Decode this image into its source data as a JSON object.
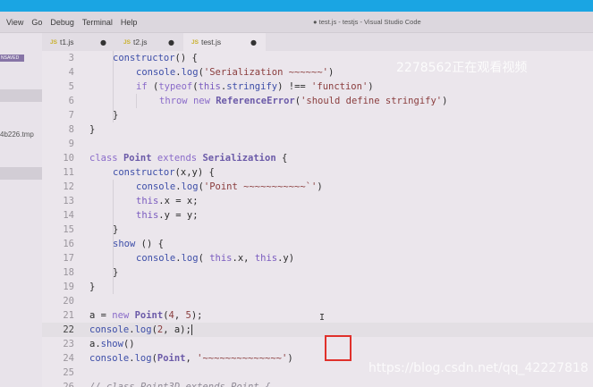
{
  "menu": [
    "View",
    "Go",
    "Debug",
    "Terminal",
    "Help"
  ],
  "window_title": "● test.js - testjs - Visual Studio Code",
  "tabs": [
    {
      "icon": "JS",
      "label": "t1.js",
      "modified": "●"
    },
    {
      "icon": "JS",
      "label": "t2.js",
      "modified": "●"
    },
    {
      "icon": "JS",
      "label": "test.js",
      "modified": "●"
    }
  ],
  "sidebar": {
    "badge": "NSAVED",
    "file": "4b226.tmp"
  },
  "editor": {
    "current_line": 22,
    "lines": [
      {
        "n": "3",
        "text": "constructor() {"
      },
      {
        "n": "4",
        "text": "console.log('Serialization ~~~~~~')"
      },
      {
        "n": "5",
        "text": "if (typeof(this.stringify) !== 'function')"
      },
      {
        "n": "6",
        "text": "throw new ReferenceError('should define stringify')"
      },
      {
        "n": "7",
        "text": "}"
      },
      {
        "n": "8",
        "text": "}"
      },
      {
        "n": "9",
        "text": ""
      },
      {
        "n": "10",
        "text": "class Point extends Serialization {"
      },
      {
        "n": "11",
        "text": "constructor(x,y) {"
      },
      {
        "n": "12",
        "text": "console.log('Point ~~~~~~~~~~~`')"
      },
      {
        "n": "13",
        "text": "this.x = x;"
      },
      {
        "n": "14",
        "text": "this.y = y;"
      },
      {
        "n": "15",
        "text": "}"
      },
      {
        "n": "16",
        "text": "show () {"
      },
      {
        "n": "17",
        "text": "console.log( this.x, this.y)"
      },
      {
        "n": "18",
        "text": "}"
      },
      {
        "n": "19",
        "text": "}"
      },
      {
        "n": "20",
        "text": ""
      },
      {
        "n": "21",
        "text": "a = new Point(4, 5);"
      },
      {
        "n": "22",
        "text": "console.log(2, a);"
      },
      {
        "n": "23",
        "text": "a.show()"
      },
      {
        "n": "24",
        "text": "console.log(Point, '~~~~~~~~~~~~~~')"
      },
      {
        "n": "25",
        "text": ""
      },
      {
        "n": "26",
        "text": "// class Point3D extends Point {"
      }
    ]
  },
  "overlays": {
    "watermark_top": "2278562正在观看视频",
    "watermark_bottom": "https://blog.csdn.net/qq_42227818"
  }
}
